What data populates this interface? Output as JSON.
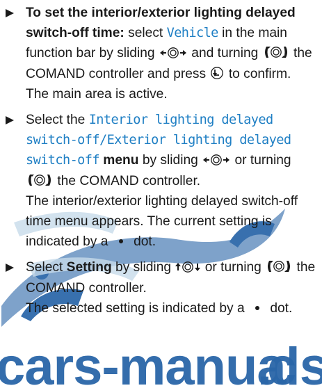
{
  "watermark": {
    "text": "cars-manuals.com",
    "colors": [
      "#2a66a8",
      "#b9cfe3"
    ]
  },
  "steps": [
    {
      "lead_bold": "To set the interior/exterior lighting delayed switch-off time:",
      "t1": "select",
      "menu_item": "Vehicle",
      "t2": "in the main function bar by sliding",
      "t3": "and turning",
      "t4": "the COMAND controller and press",
      "t5": "to confirm.",
      "result": "The main area is active."
    },
    {
      "t1": "Select the",
      "menu_a": "Interior lighting delayed switch-off",
      "sep": "/",
      "menu_b": "Exterior lighting delayed switch-off",
      "menu_bold": "menu",
      "t2": "by sliding",
      "t3": "or turning",
      "t4": "the COMAND controller.",
      "result1": "The interior/exterior lighting delayed switch-off time menu appears. The current setting is indicated by a",
      "result2": "dot."
    },
    {
      "t1": "Select",
      "setting_bold": "Setting",
      "t2": "by sliding",
      "t3": "or turning",
      "t4": "the COMAND controller.",
      "result1": "The selected setting is indicated by a",
      "result2": "dot."
    }
  ],
  "icons": [
    "slide-left-right-icon",
    "turn-controller-icon",
    "press-controller-icon",
    "slide-up-down-icon",
    "dot-icon"
  ]
}
